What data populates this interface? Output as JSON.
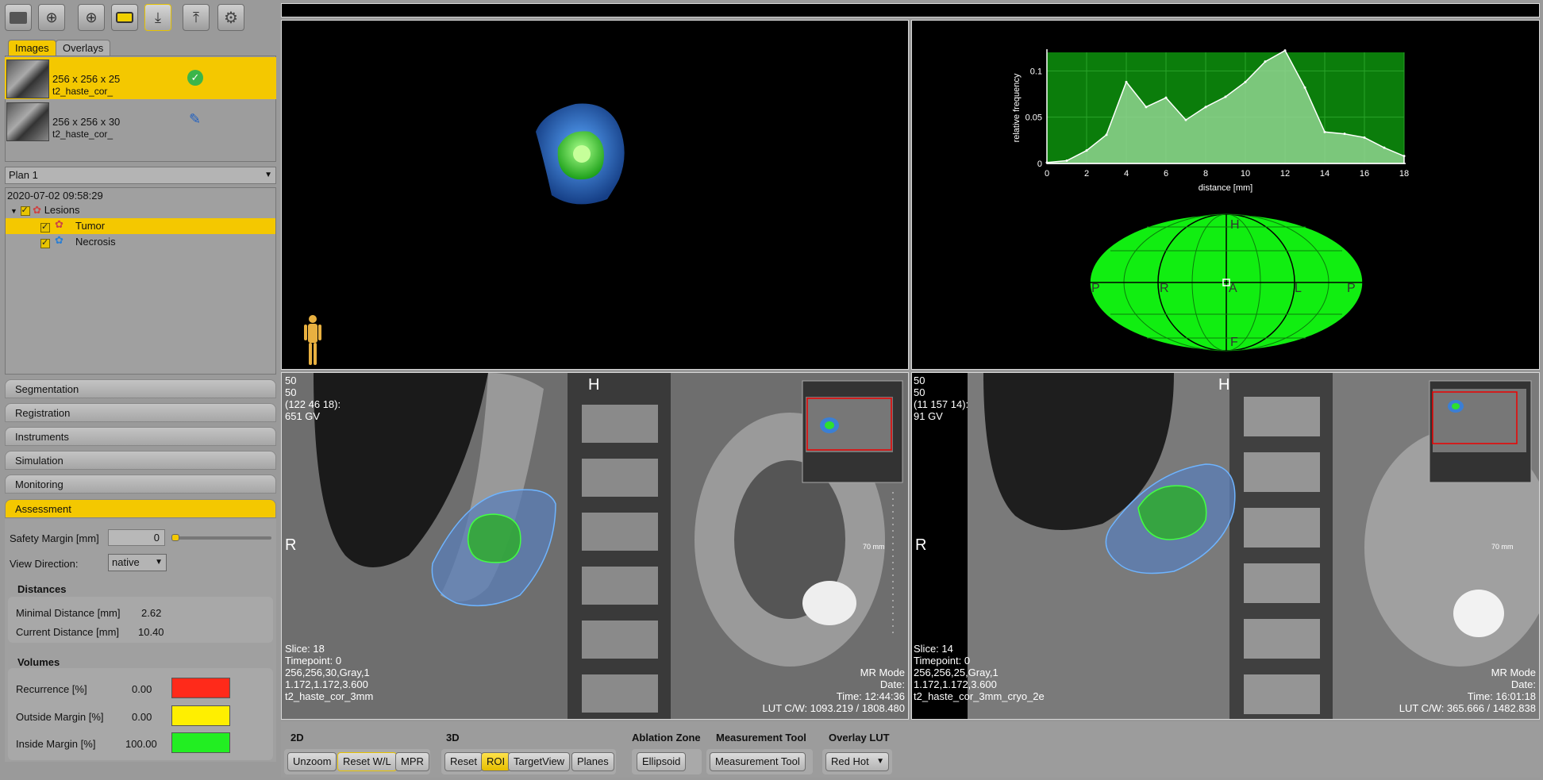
{
  "toolbar": {
    "icons": [
      "folder-open-icon",
      "needle-add-icon",
      "overlay-add-icon",
      "overlay-add-yellow-icon",
      "import-icon",
      "export-icon",
      "gear-icon"
    ]
  },
  "tabs": {
    "images": "Images",
    "overlays": "Overlays"
  },
  "images": [
    {
      "dims": "256 x 256 x 25",
      "name": "t2_haste_cor_",
      "status_icon": "check-icon"
    },
    {
      "dims": "256 x 256 x 30",
      "name": "t2_haste_cor_",
      "status_icon": "user-edit-icon"
    }
  ],
  "plan": {
    "selected": "Plan 1"
  },
  "tree": {
    "timestamp": "2020-07-02 09:58:29",
    "root": "Lesions",
    "children": [
      "Tumor",
      "Necrosis"
    ]
  },
  "sections": [
    "Segmentation",
    "Registration",
    "Instruments",
    "Simulation",
    "Monitoring",
    "Assessment"
  ],
  "assessment": {
    "safety_margin_label": "Safety Margin [mm]",
    "safety_margin_value": "0",
    "view_direction_label": "View Direction:",
    "view_direction_value": "native",
    "distances_title": "Distances",
    "min_distance_label": "Minimal Distance [mm]",
    "min_distance_value": "2.62",
    "cur_distance_label": "Current Distance [mm]",
    "cur_distance_value": "10.40",
    "volumes_title": "Volumes",
    "volumes": [
      {
        "label": "Recurrence [%]",
        "value": "0.00",
        "color": "#ff2a1a"
      },
      {
        "label": "Outside Margin [%]",
        "value": "0.00",
        "color": "#ffef00"
      },
      {
        "label": "Inside Margin [%]",
        "value": "100.00",
        "color": "#22ee22"
      }
    ]
  },
  "chart_data": {
    "type": "area",
    "xlabel": "distance [mm]",
    "ylabel": "relative frequency",
    "xlim": [
      0,
      18
    ],
    "ylim": [
      0,
      0.12
    ],
    "xticks": [
      "0",
      "2",
      "4",
      "6",
      "8",
      "10",
      "12",
      "14",
      "16",
      "18"
    ],
    "yticks": [
      "0",
      "0.05",
      "0.1"
    ],
    "x": [
      0,
      1,
      2,
      3,
      4,
      5,
      6,
      7,
      8,
      9,
      10,
      11,
      12,
      13,
      14,
      15,
      16,
      17,
      18
    ],
    "values": [
      0.001,
      0.003,
      0.014,
      0.031,
      0.088,
      0.061,
      0.071,
      0.047,
      0.061,
      0.072,
      0.088,
      0.11,
      0.122,
      0.082,
      0.034,
      0.032,
      0.028,
      0.017,
      0.008
    ]
  },
  "mollweide_labels": {
    "top": "H",
    "bottom": "F",
    "left": "P",
    "left2": "R",
    "center": "A",
    "right2": "L",
    "right": "P"
  },
  "views": [
    {
      "top_lines": [
        "50",
        "50",
        "(122 46 18):",
        "651 GV"
      ],
      "orient_top": "H",
      "orient_left": "R",
      "scale": "70 mm",
      "bottom_left": [
        "Slice: 18",
        "Timepoint: 0",
        "256,256,30,Gray,1",
        "1.172,1.172,3.600",
        "t2_haste_cor_3mm"
      ],
      "bottom_right": [
        "MR Mode",
        "Date:",
        "Time: 12:44:36",
        "LUT C/W: 1093.219 / 1808.480"
      ]
    },
    {
      "top_lines": [
        "50",
        "50",
        "(11 157 14):",
        "91 GV"
      ],
      "orient_top": "H",
      "orient_left": "R",
      "scale": "70 mm",
      "bottom_left": [
        "Slice: 14",
        "Timepoint: 0",
        "256,256,25,Gray,1",
        "1.172,1.172,3.600",
        "t2_haste_cor_3mm_cryo_2e"
      ],
      "bottom_right": [
        "MR Mode",
        "Date:",
        "Time: 16:01:18",
        "LUT C/W: 365.666 / 1482.838"
      ]
    }
  ],
  "bottom": {
    "g2d": {
      "title": "2D",
      "buttons": [
        "Unzoom",
        "Reset W/L",
        "MPR"
      ]
    },
    "g3d": {
      "title": "3D",
      "buttons": [
        "Reset",
        "ROI",
        "TargetView",
        "Planes"
      ]
    },
    "ablation": {
      "title": "Ablation Zone",
      "button": "Ellipsoid"
    },
    "measure": {
      "title": "Measurement Tool",
      "button": "Measurement Tool"
    },
    "lut": {
      "title": "Overlay LUT",
      "value": "Red Hot"
    }
  }
}
